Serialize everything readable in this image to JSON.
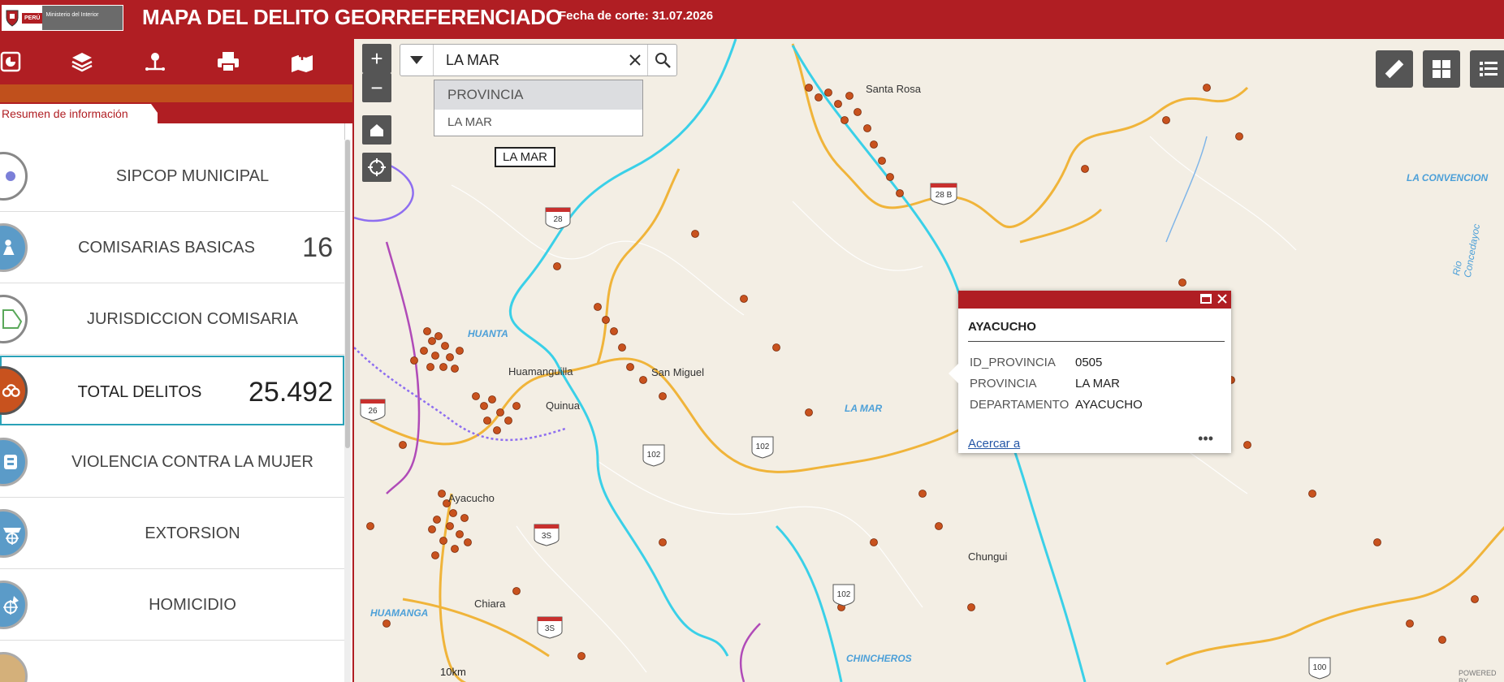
{
  "header": {
    "logo_peru": "PERÚ",
    "logo_ministry": "Ministerio del Interior",
    "title": "MAPA DEL DELITO GEORREFERENCIADO",
    "fecha": "Fecha de corte: 31.07.2026"
  },
  "toolbar": {
    "icons": [
      "chart-icon",
      "layers-icon",
      "route-icon",
      "print-icon",
      "map-add-icon"
    ]
  },
  "sidebar": {
    "tab_label": "Resumen de información",
    "items": [
      {
        "label": "SIPCOP MUNICIPAL",
        "count": ""
      },
      {
        "label": "COMISARIAS BASICAS",
        "count": "16"
      },
      {
        "label": "JURISDICCION COMISARIA",
        "count": ""
      },
      {
        "label": "TOTAL DELITOS",
        "count": "25.492"
      },
      {
        "label": "VIOLENCIA CONTRA LA MUJER",
        "count": ""
      },
      {
        "label": "EXTORSION",
        "count": ""
      },
      {
        "label": "HOMICIDIO",
        "count": ""
      }
    ]
  },
  "search": {
    "value": "LA MAR",
    "suggestion_header": "PROVINCIA",
    "suggestion_item": "LA MAR"
  },
  "map": {
    "highlight_label": "LA MAR",
    "place_labels": [
      "San Miguel",
      "Chungui",
      "Chiara",
      "Santa Rosa",
      "Huamanguilla",
      "Quinua",
      "Ayacucho"
    ],
    "area_labels": [
      "LA MAR",
      "HUANTA",
      "HUAMANGA",
      "CHINCHEROS",
      "LA CONVENCION"
    ],
    "river_label": "Rio Concedayoc",
    "roads": [
      "28",
      "28 B",
      "26",
      "102",
      "102",
      "102",
      "3S",
      "3S",
      "100"
    ],
    "scale": "10km",
    "powered": "POWERED BY"
  },
  "popup": {
    "title": "AYACUCHO",
    "rows": [
      {
        "key": "ID_PROVINCIA",
        "value": "0505"
      },
      {
        "key": "PROVINCIA",
        "value": "LA MAR"
      },
      {
        "key": "DEPARTAMENTO",
        "value": "AYACUCHO"
      }
    ],
    "zoom_link": "Acercar a",
    "more": "•••"
  },
  "colors": {
    "brand_red": "#b01e23",
    "active_border": "#2aa2b8",
    "incident_dot": "#c8521e"
  }
}
